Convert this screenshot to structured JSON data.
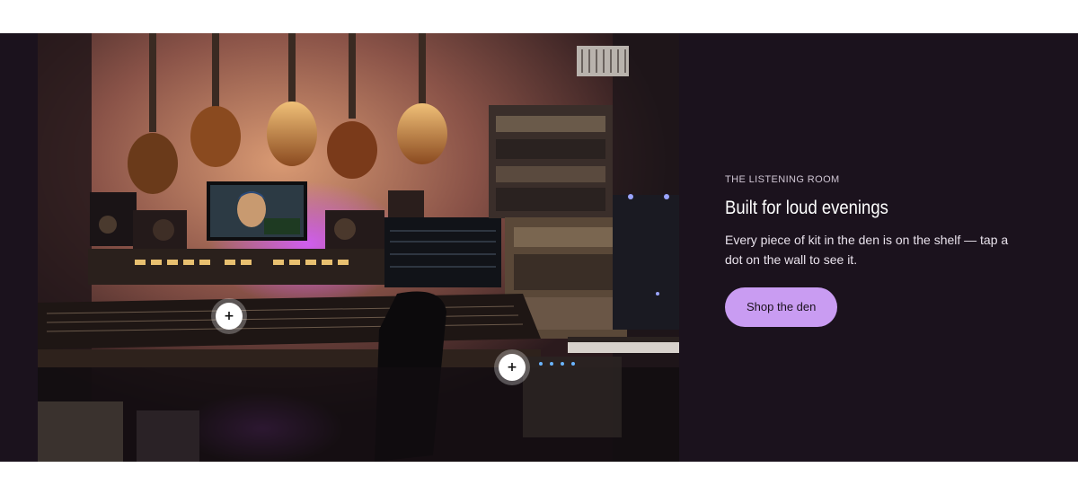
{
  "section": {
    "eyebrow": "THE LISTENING ROOM",
    "heading": "Built for loud evenings",
    "body": "Every piece of kit in the den is on the shelf — tap a dot on the wall to see it.",
    "cta_label": "Shop the den"
  },
  "hotspots": [
    {
      "icon": "plus-icon",
      "glyph": "+"
    },
    {
      "icon": "plus-icon",
      "glyph": "+"
    }
  ],
  "colors": {
    "panel_background": "#1b121d",
    "accent_button": "#c99cf2",
    "page_background": "#ffffff"
  }
}
